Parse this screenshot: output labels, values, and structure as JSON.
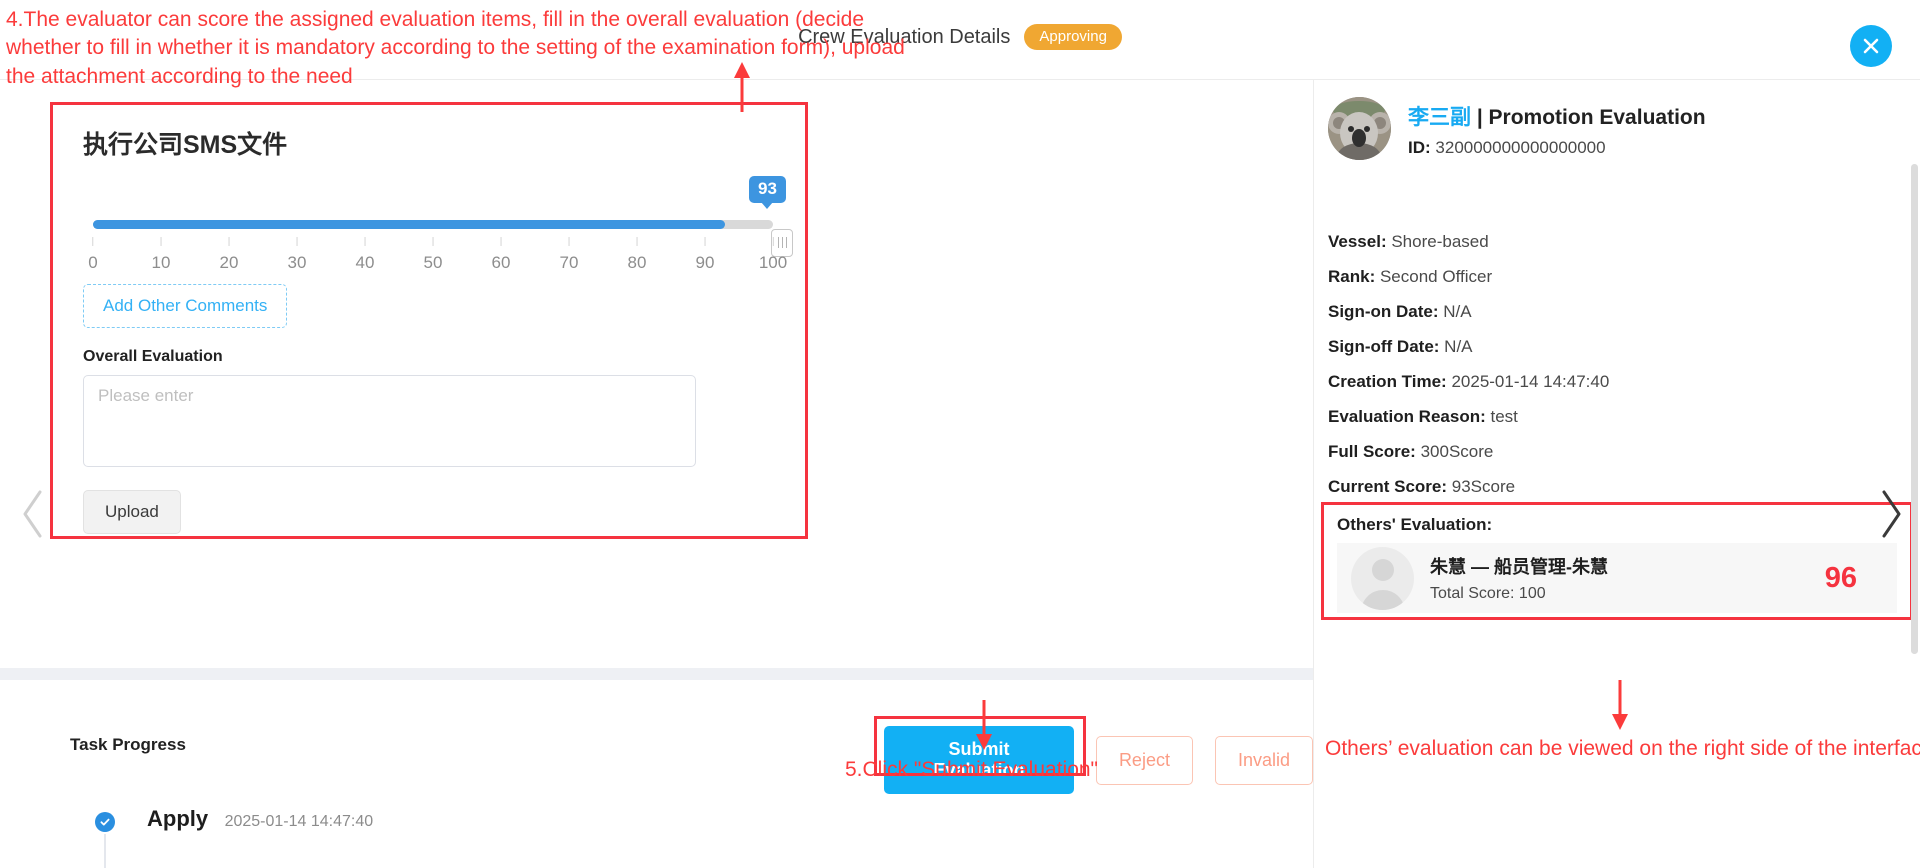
{
  "header": {
    "title": "Crew Evaluation Details",
    "status_badge": "Approving",
    "close_icon": "close-icon"
  },
  "annotations": {
    "top": "4.The evaluator can score the assigned evaluation items, fill in the overall evaluation (decide whether to fill in whether it is mandatory according to the setting of the examination form), upload the attachment according to the need",
    "submit": "5.Click \"Submit Evaluation\"",
    "others": "Others’  evaluation can be viewed on the right side of the interface"
  },
  "evaluation_card": {
    "item_title": "执行公司SMS文件",
    "slider": {
      "value": 93,
      "min": 0,
      "max": 100,
      "ticks": [
        "0",
        "10",
        "20",
        "30",
        "40",
        "50",
        "60",
        "70",
        "80",
        "90",
        "100"
      ],
      "fill_color": "#3d95e0",
      "track_color": "#d9d9d9"
    },
    "add_comments_label": "Add Other Comments",
    "overall_evaluation_label": "Overall Evaluation",
    "overall_evaluation_value": "",
    "overall_evaluation_placeholder": "Please enter",
    "upload_label": "Upload"
  },
  "task_progress": {
    "label": "Task Progress",
    "steps": [
      {
        "title": "Apply",
        "time": "2025-01-14 14:47:40",
        "icon": "check-circle-icon"
      }
    ]
  },
  "actions": {
    "submit_label": "Submit Evaluation",
    "reject_label": "Reject",
    "invalid_label": "Invalid",
    "primary_color": "#12b0f4",
    "outline_color": "#fb9c84"
  },
  "nav": {
    "prev_icon": "chevron-left-icon",
    "next_icon": "chevron-right-icon"
  },
  "side_panel": {
    "crew_name": "李三副",
    "separator": " | ",
    "evaluation_type": "Promotion Evaluation",
    "id_label": "ID:",
    "id_value": "320000000000000000",
    "details": [
      {
        "label": "Vessel:",
        "value": "Shore-based"
      },
      {
        "label": "Rank:",
        "value": "Second Officer"
      },
      {
        "label": "Sign-on Date:",
        "value": "N/A"
      },
      {
        "label": "Sign-off Date:",
        "value": "N/A"
      },
      {
        "label": "Creation Time:",
        "value": "2025-01-14 14:47:40"
      },
      {
        "label": "Evaluation Reason:",
        "value": "  test"
      },
      {
        "label": "Full Score:",
        "value": "300Score"
      },
      {
        "label": "Current Score:",
        "value": "93Score"
      }
    ],
    "others_evaluation": {
      "title": "Others' Evaluation:",
      "entries": [
        {
          "name": "朱慧 — 船员管理-朱慧",
          "total_score_label": "Total Score: 100",
          "score": "96",
          "score_color": "#f5333f"
        }
      ]
    }
  }
}
